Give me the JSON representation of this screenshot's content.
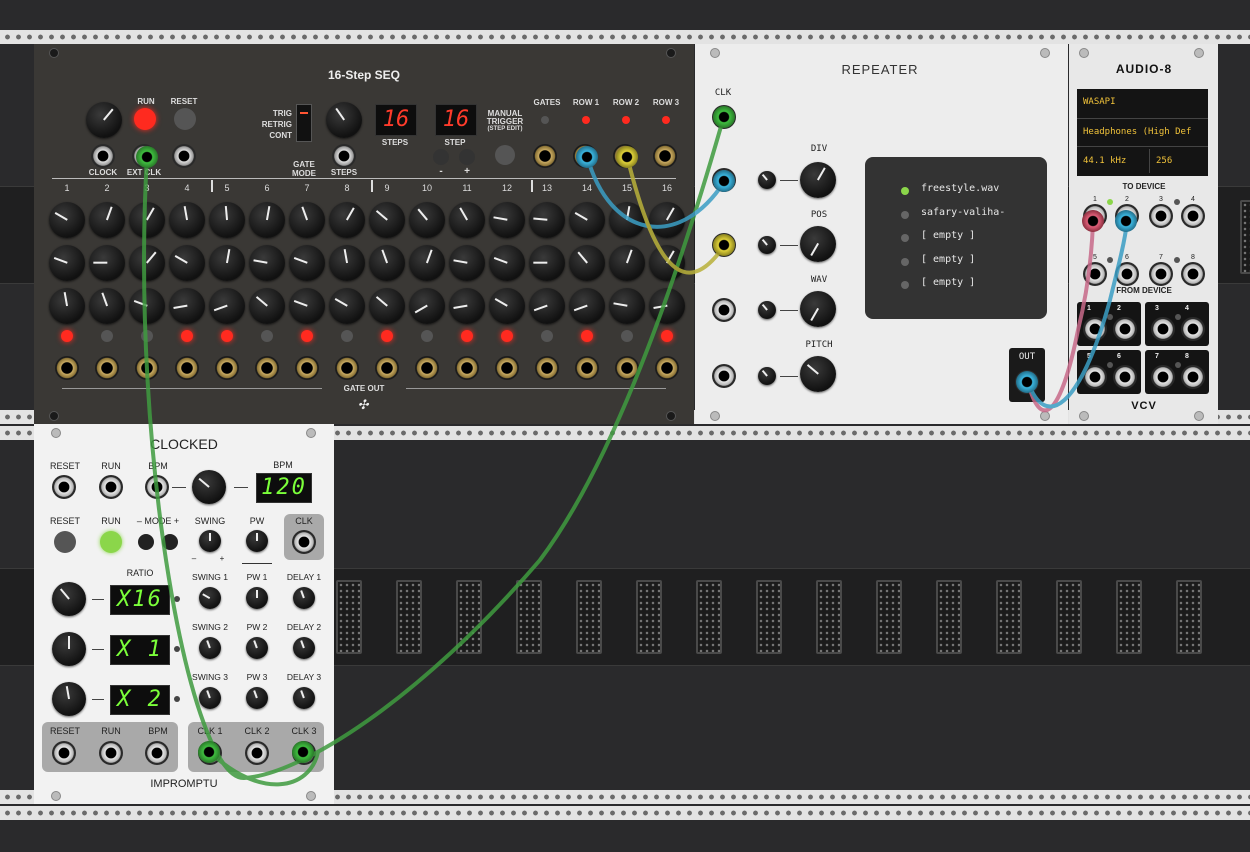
{
  "seq": {
    "title": "16-Step SEQ",
    "labels": {
      "run": "RUN",
      "reset": "RESET",
      "clock": "CLOCK",
      "ext_clk": "EXT CLK",
      "trig": "TRIG",
      "retrig": "RETRIG",
      "cont": "CONT",
      "gate_mode": "GATE\nMODE",
      "steps_label": "STEPS",
      "step_label": "STEP",
      "steps_jack": "STEPS",
      "manual_trigger": "MANUAL\nTRIGGER",
      "step_edit": "(STEP EDIT)",
      "gates": "GATES",
      "row1": "ROW 1",
      "row2": "ROW 2",
      "row3": "ROW 3",
      "gate_out": "GATE OUT",
      "minus": "-",
      "plus": "+"
    },
    "steps_value": "16",
    "step_value": "16",
    "columns": [
      "1",
      "2",
      "3",
      "4",
      "5",
      "6",
      "7",
      "8",
      "9",
      "10",
      "11",
      "12",
      "13",
      "14",
      "15",
      "16"
    ],
    "gate_leds": [
      true,
      false,
      false,
      true,
      true,
      false,
      true,
      false,
      true,
      false,
      true,
      true,
      false,
      true,
      false,
      true
    ]
  },
  "repeater": {
    "title": "REPEATER",
    "labels": {
      "clk": "CLK",
      "div": "DIV",
      "pos": "POS",
      "wav": "WAV",
      "pitch": "PITCH",
      "out": "OUT"
    },
    "files": [
      "freestyle.wav",
      "safary-valiha-",
      "[ empty ]",
      "[ empty ]",
      "[ empty ]"
    ],
    "active_file_index": 0
  },
  "audio": {
    "title": "AUDIO-8",
    "driver": "WASAPI",
    "device": "Headphones (High Def",
    "sample_rate": "44.1 kHz",
    "block_size": "256",
    "to_device": "TO DEVICE",
    "from_device": "FROM DEVICE",
    "port_numbers": [
      "1",
      "2",
      "3",
      "4",
      "5",
      "6",
      "7",
      "8"
    ],
    "brand": "VCV"
  },
  "clocked": {
    "title": "CLOCKED",
    "labels": {
      "reset": "RESET",
      "run": "RUN",
      "bpm": "BPM",
      "bpm_display_label": "BPM",
      "mode": "– MODE +",
      "swing": "SWING",
      "pw": "PW",
      "clk": "CLK",
      "ratio": "RATIO",
      "swing1": "SWING 1",
      "pw1": "PW 1",
      "delay1": "DELAY 1",
      "swing2": "SWING 2",
      "pw2": "PW 2",
      "delay2": "DELAY 2",
      "swing3": "SWING 3",
      "pw3": "PW 3",
      "delay3": "DELAY 3",
      "clk1": "CLK 1",
      "clk2": "CLK 2",
      "clk3": "CLK 3",
      "minus": "–",
      "plus": "+"
    },
    "bpm_value": "120",
    "ratios": [
      "X16",
      "X 1",
      "X 2"
    ],
    "brand": "IMPROMPTU"
  },
  "colors": {
    "cable_green": "#3f9b3f",
    "cable_blue": "#3b9ec4",
    "cable_yellow": "#b9b13a",
    "cable_pink": "#c86a8a",
    "led_red": "#ff2a1f",
    "led_green": "#8bd64a"
  }
}
